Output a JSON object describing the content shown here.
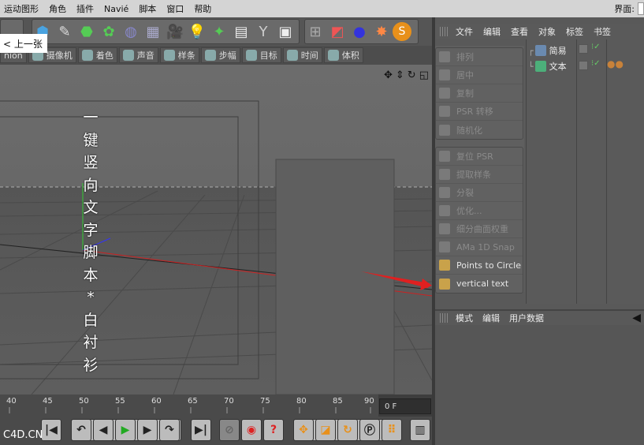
{
  "menubar": {
    "items": [
      "运动图形",
      "角色",
      "插件",
      "Navié",
      "脚本",
      "窗口",
      "帮助"
    ],
    "layout_label": "界面:"
  },
  "back_button": {
    "label": "< 上一张"
  },
  "toolbar2": {
    "items": [
      "nion",
      "摄像机",
      "着色",
      "声音",
      "样条",
      "步幅",
      "目标",
      "时间",
      "体积"
    ]
  },
  "viewport": {
    "vertical_text": [
      "一",
      "键",
      "竖",
      "向",
      "文",
      "字",
      "脚",
      "本",
      "*",
      "白",
      "衬",
      "衫"
    ]
  },
  "timeline": {
    "ticks": [
      "40",
      "45",
      "50",
      "55",
      "60",
      "65",
      "70",
      "75",
      "80",
      "85",
      "90"
    ],
    "frame_field": "0 F"
  },
  "playback": {
    "buttons": [
      "|◀",
      "◀◀",
      "◀|",
      "▶",
      "|▶",
      "▶▶",
      "▶|"
    ]
  },
  "object_manager": {
    "menu": [
      "文件",
      "编辑",
      "查看",
      "对象",
      "标签",
      "书签"
    ],
    "objects": [
      {
        "name": "简易",
        "icon": "null-icon"
      },
      {
        "name": "文本",
        "icon": "text-icon"
      }
    ]
  },
  "plugins": {
    "group1": [
      {
        "label": "排列",
        "enabled": false
      },
      {
        "label": "居中",
        "enabled": false
      },
      {
        "label": "复制",
        "enabled": false
      },
      {
        "label": "PSR 转移",
        "enabled": false
      },
      {
        "label": "随机化",
        "enabled": false
      }
    ],
    "group2": [
      {
        "label": "复位 PSR",
        "enabled": false
      },
      {
        "label": "提取样条",
        "enabled": false
      },
      {
        "label": "分裂",
        "enabled": false
      },
      {
        "label": "优化...",
        "enabled": false
      },
      {
        "label": "细分曲面权重",
        "enabled": false
      },
      {
        "label": "AMa 1D Snap",
        "enabled": false
      },
      {
        "label": "Points to Circle",
        "enabled": true
      },
      {
        "label": "vertical text",
        "enabled": true
      }
    ]
  },
  "attributes": {
    "menu": [
      "模式",
      "编辑",
      "用户数据"
    ]
  },
  "watermark": "C4D.CN",
  "colors": {
    "arrow": "#e02020",
    "viewport_bg": "#6b6b6b",
    "panel_bg": "#595959"
  }
}
